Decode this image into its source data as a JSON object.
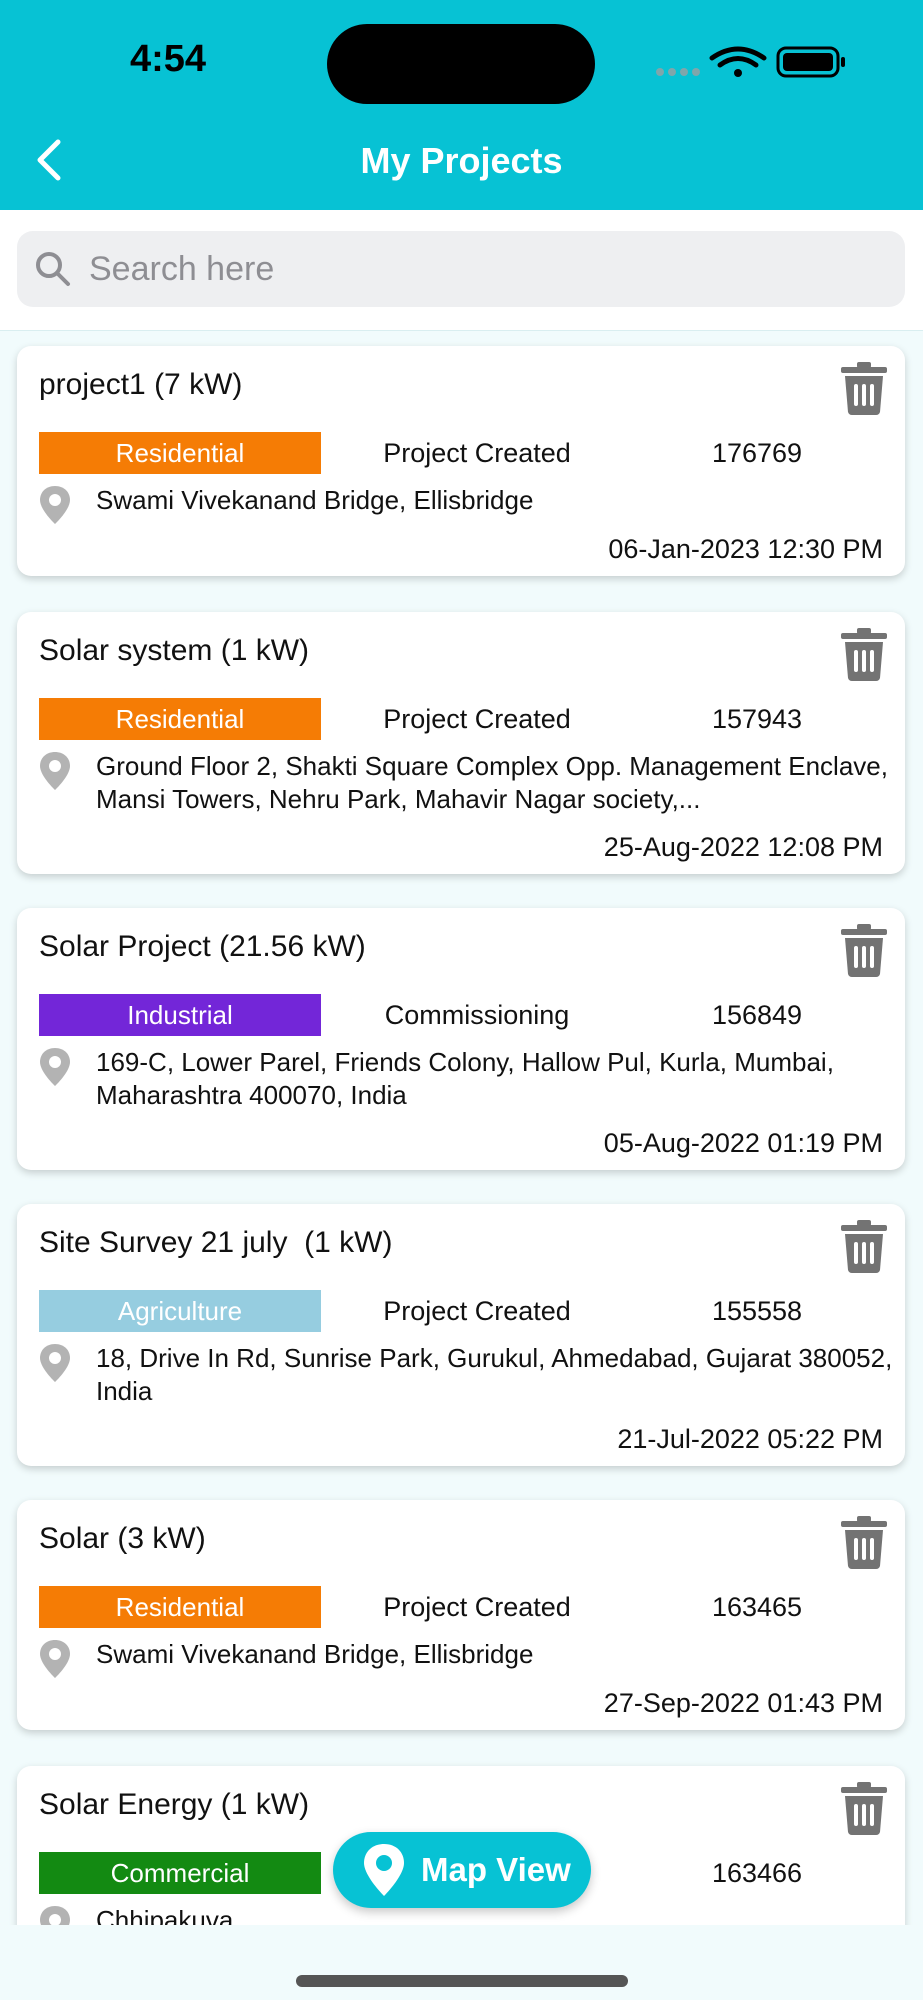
{
  "status_bar": {
    "time": "4:54"
  },
  "header": {
    "title": "My Projects"
  },
  "search": {
    "placeholder": "Search here",
    "value": ""
  },
  "projects": [
    {
      "title": "project1 (7 kW)",
      "category": "Residential",
      "category_color": "#f57c05",
      "status": "Project Created",
      "id": "176769",
      "address": "Swami Vivekanand Bridge, Ellisbridge",
      "date": "06-Jan-2023 12:30 PM"
    },
    {
      "title": "Solar system (1 kW)",
      "category": "Residential",
      "category_color": "#f57c05",
      "status": "Project Created",
      "id": "157943",
      "address": "Ground Floor 2, Shakti Square Complex Opp. Management Enclave, Mansi Towers, Nehru Park, Mahavir Nagar society,...",
      "date": "25-Aug-2022 12:08 PM"
    },
    {
      "title": "Solar Project (21.56 kW)",
      "category": "Industrial",
      "category_color": "#7326d8",
      "status": "Commissioning",
      "id": "156849",
      "address": "169-C, Lower Parel, Friends Colony, Hallow Pul, Kurla, Mumbai, Maharashtra 400070, India",
      "date": "05-Aug-2022 01:19 PM"
    },
    {
      "title": "Site Survey 21 july  (1 kW)",
      "category": "Agriculture",
      "category_color": "#96cde0",
      "status": "Project Created",
      "id": "155558",
      "address": "18, Drive In Rd, Sunrise Park, Gurukul, Ahmedabad, Gujarat 380052, India",
      "date": "21-Jul-2022 05:22 PM"
    },
    {
      "title": "Solar (3 kW)",
      "category": "Residential",
      "category_color": "#f57c05",
      "status": "Project Created",
      "id": "163465",
      "address": "Swami Vivekanand Bridge, Ellisbridge",
      "date": "27-Sep-2022 01:43 PM"
    },
    {
      "title": "Solar Energy (1 kW)",
      "category": "Commercial",
      "category_color": "#138a12",
      "status": "",
      "id": "163466",
      "address": "Chhipakuva",
      "date": ""
    }
  ],
  "map_button": {
    "label": "Map View"
  },
  "colors": {
    "accent": "#07c2d4",
    "icon_gray": "#737373",
    "pin_gray": "#b3b3b3"
  }
}
